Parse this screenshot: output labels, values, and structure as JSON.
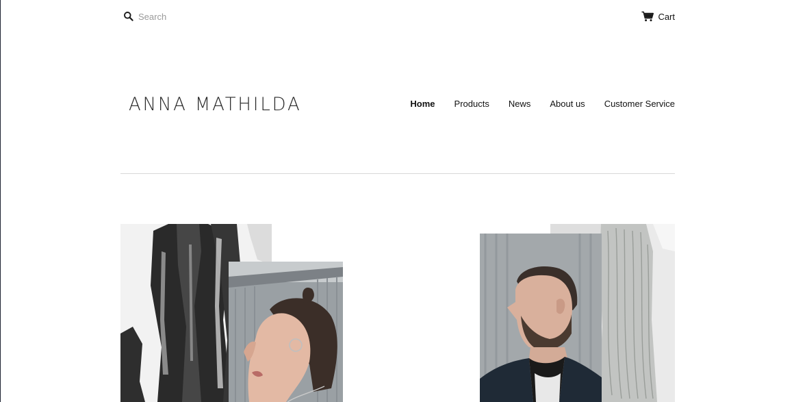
{
  "search": {
    "placeholder": "Search"
  },
  "cart": {
    "label": "Cart"
  },
  "logo": {
    "text": "ANNA MATHILDA"
  },
  "nav": {
    "items": [
      {
        "label": "Home",
        "active": true
      },
      {
        "label": "Products",
        "active": false
      },
      {
        "label": "News",
        "active": false
      },
      {
        "label": "About us",
        "active": false
      },
      {
        "label": "Customer Service",
        "active": false
      }
    ]
  },
  "icons": {
    "search": "search-icon",
    "cart": "cart-icon"
  },
  "colors": {
    "text": "#111111",
    "divider": "#d8d8d8",
    "placeholder": "#9a9a9a"
  }
}
